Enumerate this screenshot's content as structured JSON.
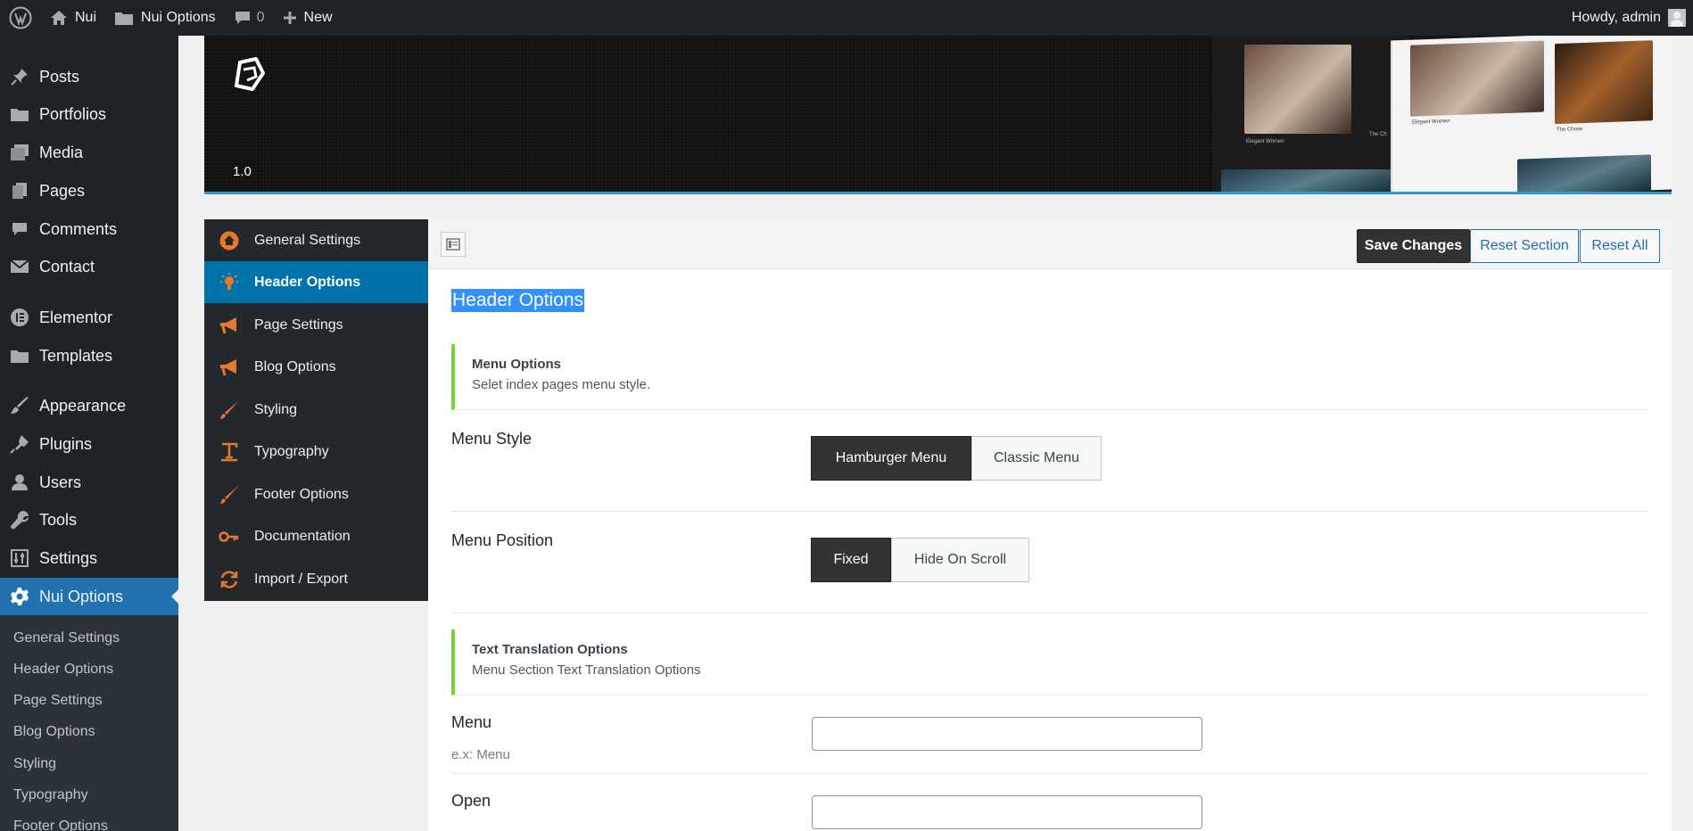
{
  "admin_bar": {
    "site_name": "Nui",
    "options_label": "Nui Options",
    "comments_count": "0",
    "new_label": "New",
    "greeting": "Howdy, admin"
  },
  "admin_menu": {
    "items": [
      {
        "label": "Posts",
        "icon": "pushpin-icon"
      },
      {
        "label": "Portfolios",
        "icon": "folder-icon"
      },
      {
        "label": "Media",
        "icon": "media-icon"
      },
      {
        "label": "Pages",
        "icon": "pages-icon"
      },
      {
        "label": "Comments",
        "icon": "comment-icon"
      },
      {
        "label": "Contact",
        "icon": "mail-icon"
      },
      {
        "label": "Elementor",
        "icon": "elementor-icon"
      },
      {
        "label": "Templates",
        "icon": "folder-icon"
      },
      {
        "label": "Appearance",
        "icon": "brush-icon"
      },
      {
        "label": "Plugins",
        "icon": "plugin-icon"
      },
      {
        "label": "Users",
        "icon": "user-icon"
      },
      {
        "label": "Tools",
        "icon": "wrench-icon"
      },
      {
        "label": "Settings",
        "icon": "settings-sliders-icon"
      },
      {
        "label": "Nui Options",
        "icon": "gear-icon",
        "active": true
      }
    ],
    "submenu": [
      "General Settings",
      "Header Options",
      "Page Settings",
      "Blog Options",
      "Styling",
      "Typography",
      "Footer Options"
    ]
  },
  "banner": {
    "version": "1.0",
    "captions": [
      "Elegant Women",
      "The Ch",
      "Elegant Women",
      "The Chose"
    ]
  },
  "options_nav": {
    "items": [
      {
        "label": "General Settings",
        "icon": "home-icon"
      },
      {
        "label": "Header Options",
        "icon": "lightbulb-icon",
        "active": true
      },
      {
        "label": "Page Settings",
        "icon": "megaphone-icon"
      },
      {
        "label": "Blog Options",
        "icon": "megaphone-icon"
      },
      {
        "label": "Styling",
        "icon": "brush-icon"
      },
      {
        "label": "Typography",
        "icon": "text-icon"
      },
      {
        "label": "Footer Options",
        "icon": "brush-icon"
      },
      {
        "label": "Documentation",
        "icon": "key-icon"
      },
      {
        "label": "Import / Export",
        "icon": "refresh-icon"
      }
    ]
  },
  "toolbar": {
    "save_label": "Save Changes",
    "reset_section_label": "Reset Section",
    "reset_all_label": "Reset All"
  },
  "section": {
    "title": "Header Options",
    "menu_options": {
      "title": "Menu Options",
      "desc": "Selet index pages menu style."
    },
    "menu_style": {
      "label": "Menu Style",
      "options": [
        "Hamburger Menu",
        "Classic Menu"
      ],
      "selected": "Hamburger Menu"
    },
    "menu_position": {
      "label": "Menu Position",
      "options": [
        "Fixed",
        "Hide On Scroll"
      ],
      "selected": "Fixed"
    },
    "translation": {
      "title": "Text Translation Options",
      "desc": "Menu Section Text Translation Options"
    },
    "menu_field": {
      "label": "Menu",
      "hint": "e.x: Menu",
      "value": ""
    },
    "open_field": {
      "label": "Open",
      "value": ""
    }
  },
  "colors": {
    "accent": "#2271b1",
    "active_nav": "#0073aa",
    "icon_orange": "#e8782e",
    "info_border": "#7ad03a",
    "dark": "#1d2327"
  }
}
